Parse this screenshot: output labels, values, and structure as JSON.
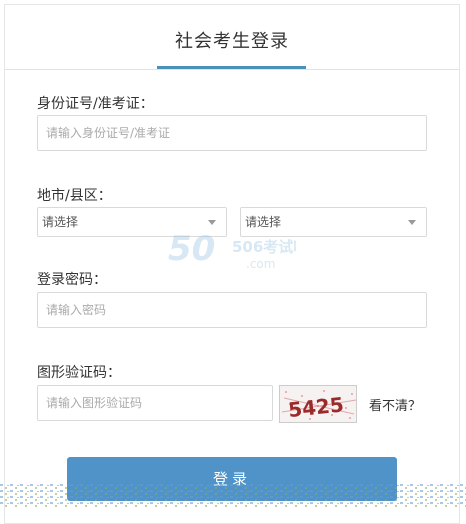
{
  "header": {
    "title": "社会考生登录"
  },
  "form": {
    "id_label": "身份证号/准考证：",
    "id_placeholder": "请输入身份证号/准考证",
    "region_label": "地市/县区：",
    "city_select": "请选择",
    "district_select": "请选择",
    "password_label": "登录密码：",
    "password_placeholder": "请输入密码",
    "captcha_label": "图形验证码：",
    "captcha_placeholder": "请输入图形验证码",
    "captcha_text": "5425",
    "refresh_text": "看不清？",
    "login_button": "登录"
  },
  "watermark": {
    "text": "506考试吧",
    "subtext": ".com"
  },
  "colors": {
    "accent": "#4a90b8",
    "button": "#4f93c8"
  }
}
